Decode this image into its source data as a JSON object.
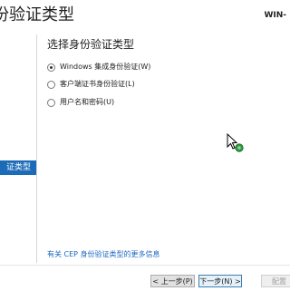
{
  "window": {
    "title": "份验证类型",
    "server_name": "WIN-"
  },
  "nav": {
    "items": [
      {
        "label": "证类型",
        "active": true
      }
    ]
  },
  "main": {
    "heading": "选择身份验证类型",
    "options": [
      {
        "label": "Windows 集成身份验证(W)",
        "checked": true
      },
      {
        "label": "客户端证书身份验证(L)",
        "checked": false
      },
      {
        "label": "用户名和密码(U)",
        "checked": false
      }
    ],
    "help_link": "有关 CEP 身份验证类型的更多信息"
  },
  "footer": {
    "back": "< 上一步(P)",
    "next": "下一步(N) >",
    "configure": "配置"
  },
  "icons": {
    "cursor": "busy-pointer-icon"
  }
}
